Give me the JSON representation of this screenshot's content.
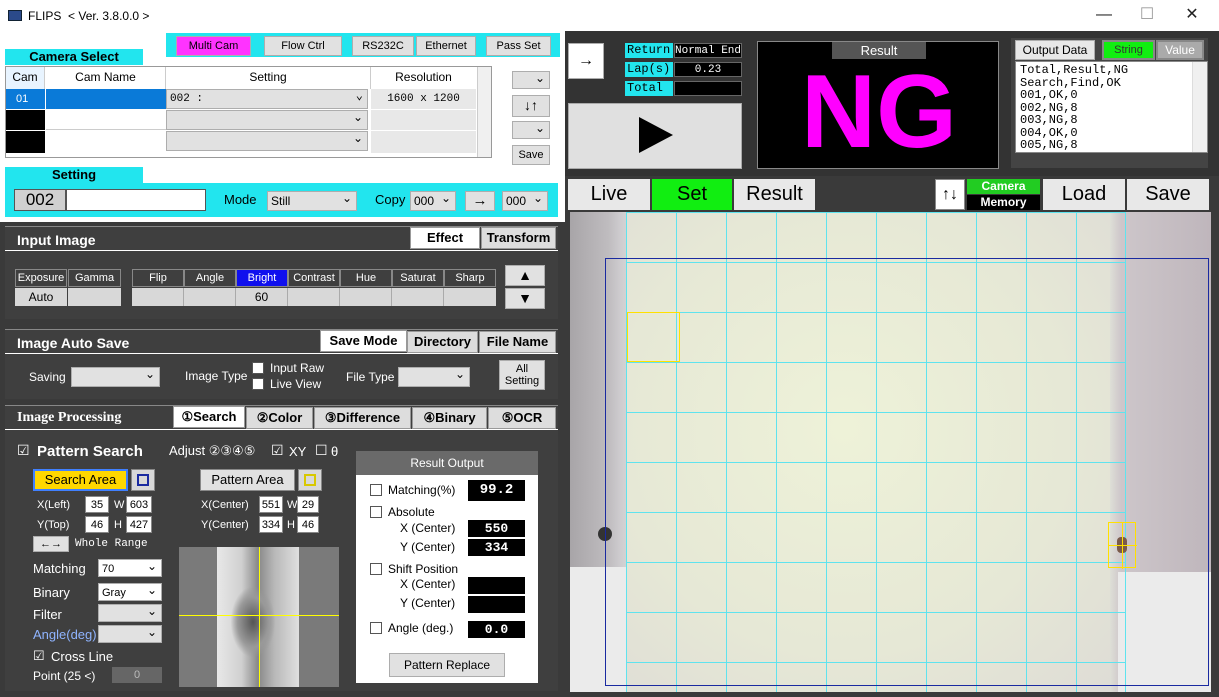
{
  "window": {
    "title": "FLIPS",
    "version": "< Ver. 3.8.0.0 >",
    "min": "—",
    "max": "☐",
    "close": "✕"
  },
  "toolbar": {
    "multicam": "Multi Cam",
    "flowctrl": "Flow Ctrl",
    "rs232c": "RS232C",
    "ethernet": "Ethernet",
    "passset": "Pass Set"
  },
  "camera_select": {
    "title": "Camera Select",
    "headers": [
      "Cam",
      "Cam Name",
      "Setting",
      "Resolution"
    ],
    "rows": [
      {
        "cam": "01",
        "name": "",
        "setting": "002 :",
        "res": "1600 x 1200"
      },
      {
        "cam": "",
        "name": "",
        "setting": "",
        "res": ""
      },
      {
        "cam": "",
        "name": "",
        "setting": "",
        "res": ""
      }
    ],
    "arrows": "↓↑",
    "save": "Save"
  },
  "setting": {
    "title": "Setting",
    "number": "002",
    "name": "",
    "mode_label": "Mode",
    "mode": "Still",
    "copy_label": "Copy",
    "copy_from": "000",
    "copy_arrow": "→",
    "copy_to": "000"
  },
  "input_image": {
    "title": "Input Image",
    "tab_effect": "Effect",
    "tab_transform": "Transform",
    "cols": [
      "Exposure",
      "Gamma",
      "Flip",
      "Angle",
      "Bright",
      "Contrast",
      "Hue",
      "Saturat",
      "Sharp"
    ],
    "vals": [
      "Auto",
      "",
      "",
      "",
      "60",
      "",
      "",
      "",
      ""
    ],
    "up": "▲",
    "down": "▼"
  },
  "auto_save": {
    "title": "Image Auto Save",
    "tab_savemode": "Save Mode",
    "tab_directory": "Directory",
    "tab_filename": "File Name",
    "saving_label": "Saving",
    "imagetype_label": "Image Type",
    "input_raw": "Input Raw",
    "live_view": "Live View",
    "filetype_label": "File Type",
    "all_setting_1": "All",
    "all_setting_2": "Setting"
  },
  "image_processing": {
    "title": "Image Processing",
    "tabs": [
      "①Search",
      "②Color",
      "③Difference",
      "④Binary",
      "⑤OCR"
    ]
  },
  "pattern": {
    "check": "☑",
    "title": "Pattern Search",
    "adjust": "Adjust ②③④⑤",
    "xy_check": "☑",
    "xy": "XY",
    "theta_check": "☐",
    "theta": "θ",
    "search_area": "Search Area",
    "pattern_area": "Pattern Area",
    "x_left_label": "X(Left)",
    "x_left": "35",
    "w_label": "W",
    "w": "603",
    "y_top_label": "Y(Top)",
    "y_top": "46",
    "h_label": "H",
    "h": "427",
    "xc_label": "X(Center)",
    "xc": "551",
    "pw_label": "W",
    "pw": "29",
    "yc_label": "Y(Center)",
    "yc": "334",
    "ph_label": "H",
    "ph": "46",
    "whole_icon": "←→",
    "whole_range": "Whole Range",
    "matching_label": "Matching",
    "matching": "70",
    "binary_label": "Binary",
    "binary": "Gray",
    "filter_label": "Filter",
    "filter": "",
    "angle_label": "Angle(deg)",
    "angle": "",
    "crossline_check": "☑",
    "crossline": "Cross Line",
    "point_label": "Point (25 <)",
    "point": "0"
  },
  "result_output": {
    "title": "Result  Output",
    "matching_label": "Matching(%)",
    "matching": "99.2",
    "absolute_label": "Absolute",
    "abs_x_label": "X (Center)",
    "abs_x": "550",
    "abs_y_label": "Y (Center)",
    "abs_y": "334",
    "shift_label": "Shift  Position",
    "shift_x_label": "X (Center)",
    "shift_x": "",
    "shift_y_label": "Y (Center)",
    "shift_y": "",
    "angle_label": "Angle (deg.)",
    "angle": "0.0",
    "replace": "Pattern Replace"
  },
  "run": {
    "arrow": "→",
    "return_label": "Return",
    "return_val": "Normal End",
    "lap_label": "Lap(s)",
    "lap_val": "0.23",
    "total_label": "Total",
    "total_val": "",
    "play": "▶"
  },
  "result": {
    "title": "Result",
    "value": "NG",
    "color": "#ff00ff"
  },
  "output_data": {
    "label": "Output Data",
    "string": "String",
    "value": "Value",
    "lines": [
      "Total,Result,NG",
      "Search,Find,OK",
      "001,OK,0",
      "002,NG,8",
      "003,NG,8",
      "004,OK,0",
      "005,NG,8"
    ]
  },
  "view": {
    "live": "Live",
    "set": "Set",
    "result": "Result",
    "swap": "↑↓",
    "camera": "Camera",
    "memory": "Memory",
    "load": "Load",
    "save": "Save"
  }
}
